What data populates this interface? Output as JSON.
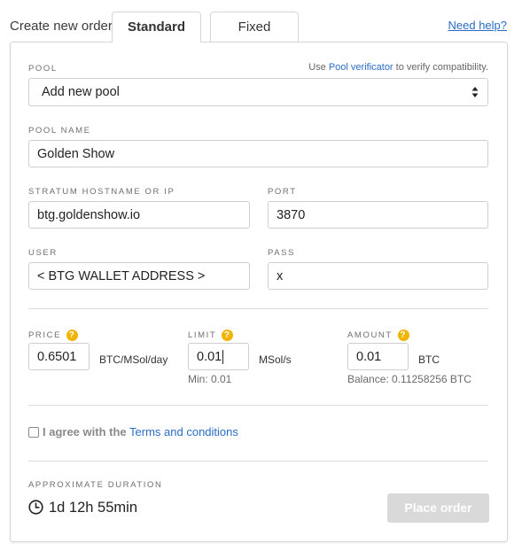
{
  "header": {
    "title": "Create new order",
    "tabs": [
      {
        "label": "Standard",
        "active": true
      },
      {
        "label": "Fixed",
        "active": false
      }
    ],
    "help_link": "Need help?"
  },
  "pool": {
    "label": "POOL",
    "note_prefix": "Use ",
    "note_link": "Pool verificator",
    "note_suffix": " to verify compatibility.",
    "selected": "Add new pool"
  },
  "pool_name": {
    "label": "POOL NAME",
    "value": "Golden Show"
  },
  "stratum": {
    "label": "STRATUM HOSTNAME OR IP",
    "value": "btg.goldenshow.io"
  },
  "port": {
    "label": "PORT",
    "value": "3870"
  },
  "user": {
    "label": "USER",
    "value": "< BTG WALLET ADDRESS >"
  },
  "pass": {
    "label": "PASS",
    "value": "x"
  },
  "price": {
    "label": "PRICE",
    "value": "0.6501",
    "unit": "BTC/MSol/day"
  },
  "limit": {
    "label": "LIMIT",
    "value": "0.01",
    "unit": "MSol/s",
    "min_text": "Min: 0.01"
  },
  "amount": {
    "label": "AMOUNT",
    "value": "0.01",
    "unit": "BTC",
    "balance_text": "Balance: 0.11258256 BTC"
  },
  "agree": {
    "checked": false,
    "text": "I agree with the",
    "terms_link": "Terms and conditions"
  },
  "duration": {
    "label": "APPROXIMATE DURATION",
    "value": "1d 12h 55min"
  },
  "place_order": {
    "label": "Place order",
    "enabled": false
  },
  "colors": {
    "accent": "#2a6cc5",
    "help_icon": "#f0b400",
    "disabled_button": "#d9d9d9"
  }
}
